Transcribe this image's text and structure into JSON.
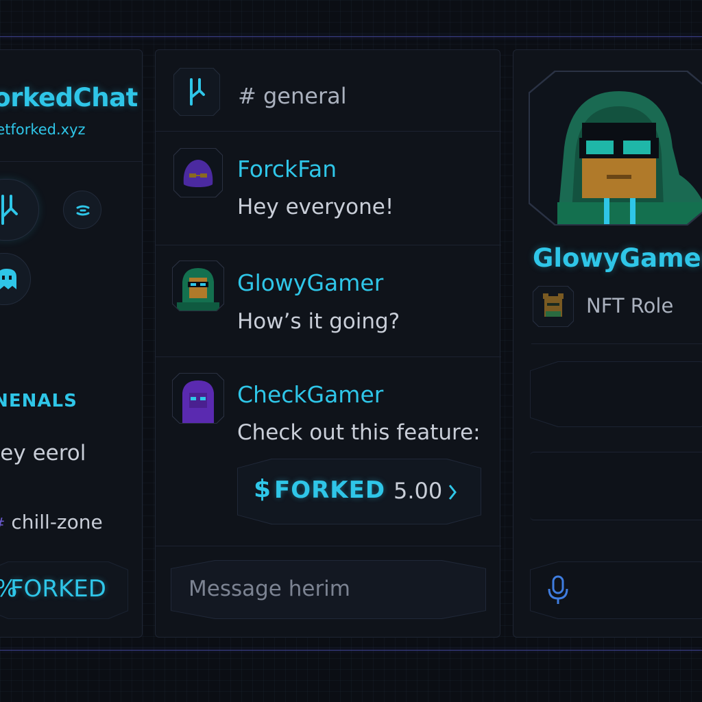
{
  "server": {
    "name": "ForkedChat",
    "domain": "netforked.xyz"
  },
  "left": {
    "section_label": "GENENALS",
    "channel_item": "Hey eerol",
    "chill_channel": "chill-zone",
    "chill_prefix": "#",
    "token_button": "FORKED",
    "token_symbol": "%"
  },
  "channel": {
    "header": "# general"
  },
  "messages": [
    {
      "user": "ForckFan",
      "text": "Hey everyone!",
      "avatar": "purple-blob-avatar"
    },
    {
      "user": "GlowyGamer",
      "text": "How’s it going?",
      "avatar": "hooded-gamer-avatar"
    },
    {
      "user": "CheckGamer",
      "text": "Check out this feature:",
      "avatar": "purple-hood-avatar"
    }
  ],
  "token_card": {
    "symbol": "$",
    "ticker": "FORKED",
    "amount": "5.00"
  },
  "composer": {
    "placeholder": "Message herim"
  },
  "profile": {
    "username": "GlowyGamer",
    "role": "NFT Role"
  },
  "colors": {
    "accent": "#2fc6e8",
    "background": "#0b0e14",
    "panel": "#0f131a",
    "text": "#c9ced8",
    "divider": "#3a3f8a"
  }
}
